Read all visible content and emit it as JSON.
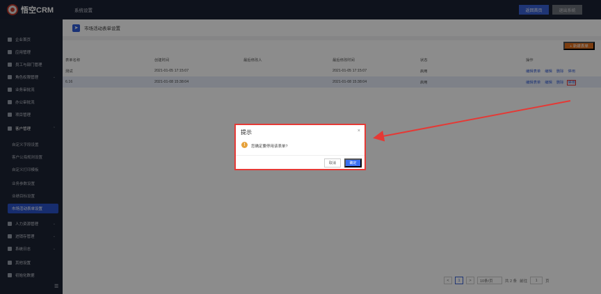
{
  "header": {
    "logo_text": "悟空CRM",
    "module_title": "系统设置",
    "home_button": "返回首页",
    "exit_button": "退出系统"
  },
  "sidebar": {
    "items": [
      {
        "label": "企业首页"
      },
      {
        "label": "应用管理"
      },
      {
        "label": "员工与部门管理"
      },
      {
        "label": "角色权限管理"
      },
      {
        "label": "业务审批流"
      },
      {
        "label": "办公审批流"
      },
      {
        "label": "项目管理"
      },
      {
        "label": "客户管理"
      }
    ],
    "sub_items": [
      {
        "label": "自定义字段设置"
      },
      {
        "label": "客户公海规则设置"
      },
      {
        "label": "自定义打印模板"
      },
      {
        "label": "业务参数设置"
      },
      {
        "label": "业绩目标设置"
      },
      {
        "label": "市场活动表单设置"
      }
    ],
    "items_after": [
      {
        "label": "人力资源管理"
      },
      {
        "label": "进销存管理"
      },
      {
        "label": "系统日志"
      },
      {
        "label": "其他设置"
      },
      {
        "label": "初始化数据"
      }
    ]
  },
  "page": {
    "title": "市场活动表单设置",
    "new_button": "+ 新建表单"
  },
  "table": {
    "columns": [
      "表单名称",
      "创建时间",
      "最后修改人",
      "最后修改时间",
      "状态",
      "操作"
    ],
    "rows": [
      {
        "name": "测试",
        "created": "2021-01-05 17:15:07",
        "modifier": "",
        "modified": "2021-01-05 17:15:07",
        "status": "启用"
      },
      {
        "name": "6.16",
        "created": "2021-01-08 15:38:04",
        "modifier": "",
        "modified": "2021-01-08 15:38:04",
        "status": "启用"
      }
    ],
    "ops": [
      "编辑表单",
      "编辑",
      "删除",
      "停用"
    ]
  },
  "pagination": {
    "prev": "<",
    "current_page": "1",
    "next": ">",
    "page_size": "10条/页",
    "total": "共 2 条",
    "goto_label": "前往",
    "goto_value": "1",
    "page_unit": "页"
  },
  "dialog": {
    "title": "提示",
    "close": "×",
    "message": "您确定要停用该表单?",
    "cancel": "取消",
    "confirm": "确定"
  },
  "colors": {
    "accent": "#3a62d6",
    "highlight_border": "#e53935",
    "new_button": "#e3721e"
  }
}
